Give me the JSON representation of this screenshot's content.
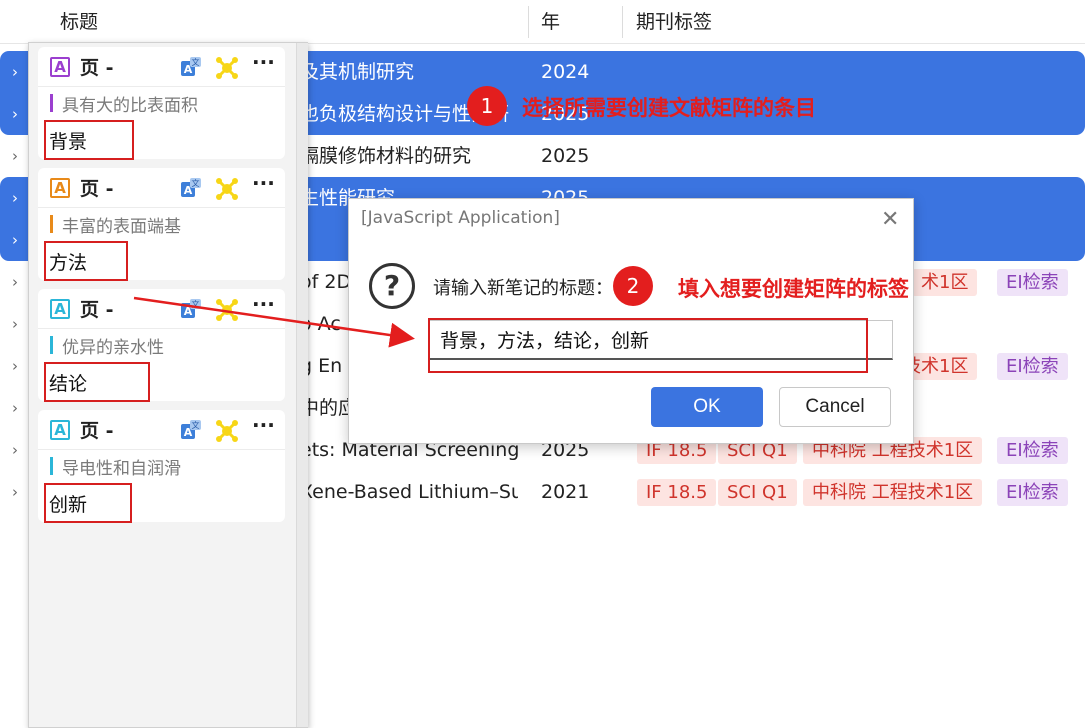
{
  "header": {
    "col_title": "标题",
    "col_year": "年",
    "col_tags": "期刊标签"
  },
  "rows": [
    {
      "title": "及其机制研究",
      "year": "2024",
      "selected": true
    },
    {
      "title": "也负极结构设计与性能研",
      "year": "2025",
      "selected": true
    },
    {
      "title": "隔膜修饰材料的研究",
      "year": "2025",
      "selected": false
    },
    {
      "title": "生性能研究",
      "year": "2025",
      "selected": true
    },
    {
      "title": "",
      "year": "",
      "selected": true
    },
    {
      "title": "of 2D",
      "year": "",
      "tags": [
        "术1区",
        "EI检索"
      ]
    },
    {
      "title": "o Ac",
      "year": ""
    },
    {
      "title": "g En",
      "year": "",
      "tags": [
        "技术1区",
        "EI检索"
      ]
    },
    {
      "title": "中的应",
      "year": ""
    },
    {
      "title": "ets: Material Screening",
      "year": "2025",
      "tags": [
        "IF 18.5",
        "SCI Q1",
        "中科院 工程技术1区",
        "EI检索"
      ]
    },
    {
      "title": "Xene-Based Lithium–Su",
      "year": "2021",
      "tags": [
        "IF 18.5",
        "SCI Q1",
        "中科院 工程技术1区",
        "EI检索"
      ]
    }
  ],
  "notes": [
    {
      "page": "页 -",
      "quote": "具有大的比表面积",
      "label": "背景",
      "color": "#9b3fcf",
      "icon": "A"
    },
    {
      "page": "页 -",
      "quote": "丰富的表面端基",
      "label": "方法",
      "color": "#e88a1a",
      "icon": "A"
    },
    {
      "page": "页 -",
      "quote": "优异的亲水性",
      "label": "结论",
      "color": "#2bb6d8",
      "icon": "A"
    },
    {
      "page": "页 -",
      "quote": "导电性和自润滑",
      "label": "创新",
      "color": "#2bb6d8",
      "icon": "A"
    }
  ],
  "dialog": {
    "title": "[JavaScript Application]",
    "prompt": "请输入新笔记的标题：",
    "input_value": "背景，方法，结论，创新",
    "ok": "OK",
    "cancel": "Cancel",
    "close": "✕",
    "question_glyph": "?"
  },
  "annotations": {
    "badge1": "1",
    "text1": "选择所需要创建文献矩阵的条目",
    "badge2": "2",
    "text2": "填入想要创建矩阵的标签"
  },
  "icons": {
    "more": "···",
    "twisty": "›"
  },
  "colors": {
    "selection": "#3b74e0",
    "annotation": "#e31e1e"
  }
}
